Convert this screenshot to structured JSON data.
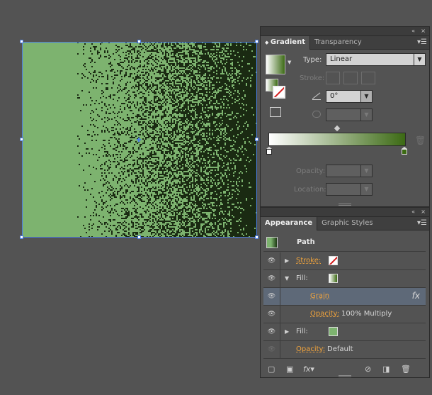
{
  "gradient_panel": {
    "tabs": [
      "Gradient",
      "Transparency"
    ],
    "type_label": "Type:",
    "type_value": "Linear",
    "stroke_label": "Stroke:",
    "angle_value": "0°",
    "opacity_label": "Opacity:",
    "location_label": "Location:",
    "ramp_start_color": "#ffffff",
    "ramp_end_color": "#3c6a14"
  },
  "appearance_panel": {
    "tabs": [
      "Appearance",
      "Graphic Styles"
    ],
    "path_label": "Path",
    "rows": {
      "stroke_label": "Stroke:",
      "fill1_label": "Fill:",
      "grain_label": "Grain",
      "fx_label": "fx",
      "opacity1_label": "Opacity:",
      "opacity1_value": "100% Multiply",
      "fill2_label": "Fill:",
      "opacity2_label": "Opacity:",
      "opacity2_value": "Default"
    },
    "fill2_color": "#7db36f"
  },
  "artwork": {
    "base_color": "#7db36f",
    "grain_dark_color": "#1a2a12"
  },
  "window": {
    "collapse_glyph": "«",
    "close_glyph": "×"
  }
}
